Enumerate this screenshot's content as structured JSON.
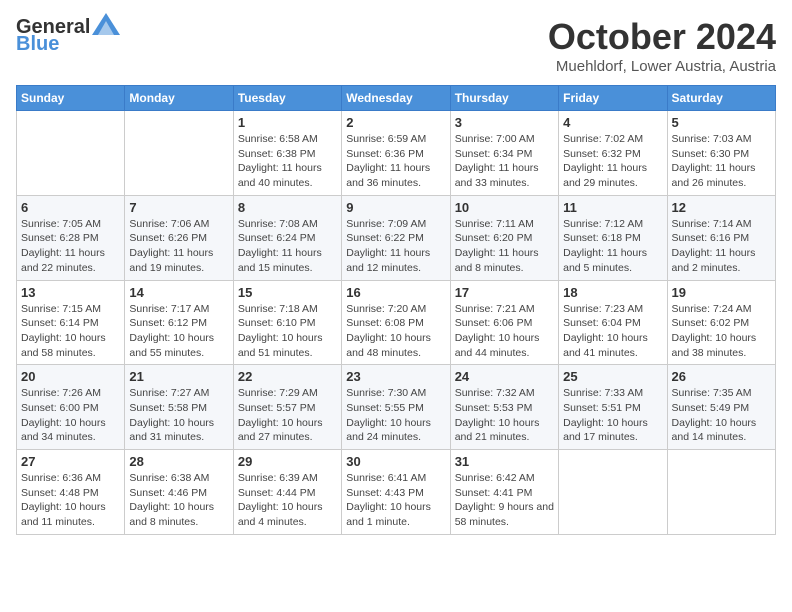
{
  "header": {
    "logo_general": "General",
    "logo_blue": "Blue",
    "month": "October 2024",
    "location": "Muehldorf, Lower Austria, Austria"
  },
  "weekdays": [
    "Sunday",
    "Monday",
    "Tuesday",
    "Wednesday",
    "Thursday",
    "Friday",
    "Saturday"
  ],
  "weeks": [
    [
      {
        "day": "",
        "info": ""
      },
      {
        "day": "",
        "info": ""
      },
      {
        "day": "1",
        "info": "Sunrise: 6:58 AM\nSunset: 6:38 PM\nDaylight: 11 hours and 40 minutes."
      },
      {
        "day": "2",
        "info": "Sunrise: 6:59 AM\nSunset: 6:36 PM\nDaylight: 11 hours and 36 minutes."
      },
      {
        "day": "3",
        "info": "Sunrise: 7:00 AM\nSunset: 6:34 PM\nDaylight: 11 hours and 33 minutes."
      },
      {
        "day": "4",
        "info": "Sunrise: 7:02 AM\nSunset: 6:32 PM\nDaylight: 11 hours and 29 minutes."
      },
      {
        "day": "5",
        "info": "Sunrise: 7:03 AM\nSunset: 6:30 PM\nDaylight: 11 hours and 26 minutes."
      }
    ],
    [
      {
        "day": "6",
        "info": "Sunrise: 7:05 AM\nSunset: 6:28 PM\nDaylight: 11 hours and 22 minutes."
      },
      {
        "day": "7",
        "info": "Sunrise: 7:06 AM\nSunset: 6:26 PM\nDaylight: 11 hours and 19 minutes."
      },
      {
        "day": "8",
        "info": "Sunrise: 7:08 AM\nSunset: 6:24 PM\nDaylight: 11 hours and 15 minutes."
      },
      {
        "day": "9",
        "info": "Sunrise: 7:09 AM\nSunset: 6:22 PM\nDaylight: 11 hours and 12 minutes."
      },
      {
        "day": "10",
        "info": "Sunrise: 7:11 AM\nSunset: 6:20 PM\nDaylight: 11 hours and 8 minutes."
      },
      {
        "day": "11",
        "info": "Sunrise: 7:12 AM\nSunset: 6:18 PM\nDaylight: 11 hours and 5 minutes."
      },
      {
        "day": "12",
        "info": "Sunrise: 7:14 AM\nSunset: 6:16 PM\nDaylight: 11 hours and 2 minutes."
      }
    ],
    [
      {
        "day": "13",
        "info": "Sunrise: 7:15 AM\nSunset: 6:14 PM\nDaylight: 10 hours and 58 minutes."
      },
      {
        "day": "14",
        "info": "Sunrise: 7:17 AM\nSunset: 6:12 PM\nDaylight: 10 hours and 55 minutes."
      },
      {
        "day": "15",
        "info": "Sunrise: 7:18 AM\nSunset: 6:10 PM\nDaylight: 10 hours and 51 minutes."
      },
      {
        "day": "16",
        "info": "Sunrise: 7:20 AM\nSunset: 6:08 PM\nDaylight: 10 hours and 48 minutes."
      },
      {
        "day": "17",
        "info": "Sunrise: 7:21 AM\nSunset: 6:06 PM\nDaylight: 10 hours and 44 minutes."
      },
      {
        "day": "18",
        "info": "Sunrise: 7:23 AM\nSunset: 6:04 PM\nDaylight: 10 hours and 41 minutes."
      },
      {
        "day": "19",
        "info": "Sunrise: 7:24 AM\nSunset: 6:02 PM\nDaylight: 10 hours and 38 minutes."
      }
    ],
    [
      {
        "day": "20",
        "info": "Sunrise: 7:26 AM\nSunset: 6:00 PM\nDaylight: 10 hours and 34 minutes."
      },
      {
        "day": "21",
        "info": "Sunrise: 7:27 AM\nSunset: 5:58 PM\nDaylight: 10 hours and 31 minutes."
      },
      {
        "day": "22",
        "info": "Sunrise: 7:29 AM\nSunset: 5:57 PM\nDaylight: 10 hours and 27 minutes."
      },
      {
        "day": "23",
        "info": "Sunrise: 7:30 AM\nSunset: 5:55 PM\nDaylight: 10 hours and 24 minutes."
      },
      {
        "day": "24",
        "info": "Sunrise: 7:32 AM\nSunset: 5:53 PM\nDaylight: 10 hours and 21 minutes."
      },
      {
        "day": "25",
        "info": "Sunrise: 7:33 AM\nSunset: 5:51 PM\nDaylight: 10 hours and 17 minutes."
      },
      {
        "day": "26",
        "info": "Sunrise: 7:35 AM\nSunset: 5:49 PM\nDaylight: 10 hours and 14 minutes."
      }
    ],
    [
      {
        "day": "27",
        "info": "Sunrise: 6:36 AM\nSunset: 4:48 PM\nDaylight: 10 hours and 11 minutes."
      },
      {
        "day": "28",
        "info": "Sunrise: 6:38 AM\nSunset: 4:46 PM\nDaylight: 10 hours and 8 minutes."
      },
      {
        "day": "29",
        "info": "Sunrise: 6:39 AM\nSunset: 4:44 PM\nDaylight: 10 hours and 4 minutes."
      },
      {
        "day": "30",
        "info": "Sunrise: 6:41 AM\nSunset: 4:43 PM\nDaylight: 10 hours and 1 minute."
      },
      {
        "day": "31",
        "info": "Sunrise: 6:42 AM\nSunset: 4:41 PM\nDaylight: 9 hours and 58 minutes."
      },
      {
        "day": "",
        "info": ""
      },
      {
        "day": "",
        "info": ""
      }
    ]
  ]
}
